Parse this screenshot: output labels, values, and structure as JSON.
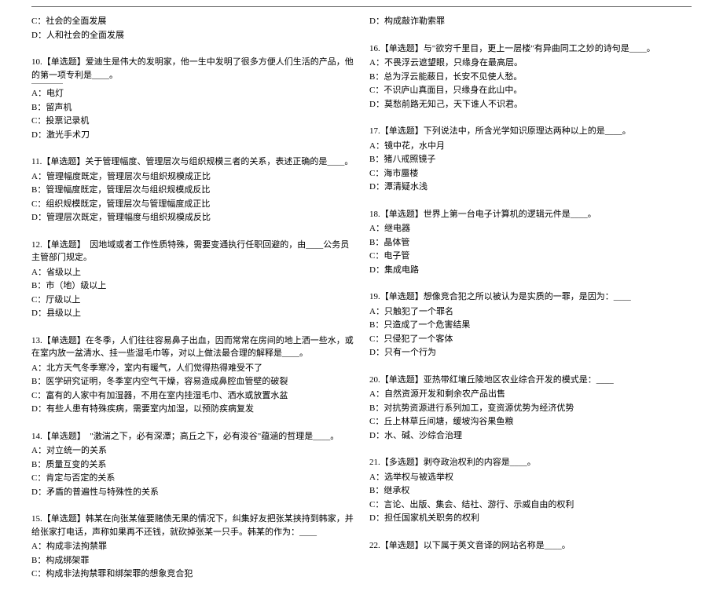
{
  "left": {
    "q9_opts": [
      "C：社会的全面发展",
      "D：人和社会的全面发展"
    ],
    "q10": {
      "stem": "10.【单选题】爱迪生是伟大的发明家，他一生中发明了很多方便人们生活的产品，他的第一项专利是____。",
      "opts": [
        "A：电灯",
        "B：留声机",
        "C：投票记录机",
        "D：激光手术刀"
      ]
    },
    "q11": {
      "stem": "11.【单选题】关于管理幅度、管理层次与组织规模三者的关系，表述正确的是____。",
      "opts": [
        "A：管理幅度既定，管理层次与组织规模成正比",
        "B：管理幅度既定，管理层次与组织规模成反比",
        "C：组织规模既定，管理层次与管理幅度成正比",
        "D：管理层次既定，管理幅度与组织规模成反比"
      ]
    },
    "q12": {
      "stem": "12.【单选题】　因地域或者工作性质特殊，需要变通执行任职回避的，由____公务员主管部门规定。",
      "opts": [
        "A：省级以上",
        "B：市（地）级以上",
        "C：厅级以上",
        "D：县级以上"
      ]
    },
    "q13": {
      "stem": "13.【单选题】在冬季，人们往往容易鼻子出血，因而常常在房间的地上洒一些水，或在室内放一盆清水、挂一些湿毛巾等，对以上做法最合理的解释是____。",
      "opts": [
        "A：北方天气冬季寒冷，室内有暖气，人们觉得热得难受不了",
        "B：医学研究证明，冬季室内空气干燥，容易造成鼻腔血管壁的破裂",
        "C：富有的人家中有加湿器，不用在室内挂湿毛巾、洒水或放置水盆",
        "D：有些人患有特殊疾病，需要室内加湿，以预防疾病复发"
      ]
    },
    "q14": {
      "stem": "14.【单选题】　\"激湍之下，必有深潭；高丘之下，必有浚谷\"蕴涵的哲理是____。",
      "opts": [
        "A：对立统一的关系",
        "B：质量互变的关系",
        "C：肯定与否定的关系",
        "D：矛盾的普遍性与特殊性的关系"
      ]
    },
    "q15": {
      "stem": "15.【单选题】韩某在向张某催要赌债无果的情况下，纠集好友把张某挟持到韩家，并给张家打电话，声称如果再不还钱，就砍掉张某一只手。韩某的作为：____",
      "opts": [
        "A：构成非法拘禁罪",
        "B：构成绑架罪",
        "C：构成非法拘禁罪和绑架罪的想象竞合犯"
      ]
    }
  },
  "right": {
    "q15d": "D：构成敲诈勒索罪",
    "q16": {
      "stem": "16.【单选题】与\"欲穷千里目，更上一层楼\"有异曲同工之妙的诗句是____。",
      "opts": [
        "A：不畏浮云遮望眼，只缘身在最高层。",
        "B：总为浮云能蔽日，长安不见使人愁。",
        "C：不识庐山真面目，只缘身在此山中。",
        "D：莫愁前路无知己，天下谁人不识君。"
      ]
    },
    "q17": {
      "stem": "17.【单选题】下列说法中，所含光学知识原理达两种以上的是____。",
      "opts": [
        "A：镜中花，水中月",
        "B：猪八戒照镜子",
        "C：海市蜃楼",
        "D：潭清疑水浅"
      ]
    },
    "q18": {
      "stem": "18.【单选题】世界上第一台电子计算机的逻辑元件是____。",
      "opts": [
        "A：继电器",
        "B：晶体管",
        "C：电子管",
        "D：集成电路"
      ]
    },
    "q19": {
      "stem": "19.【单选题】想像竞合犯之所以被认为是实质的一罪，是因为：____",
      "opts": [
        "A：只触犯了一个罪名",
        "B：只造成了一个危害结果",
        "C：只侵犯了一个客体",
        "D：只有一个行为"
      ]
    },
    "q20": {
      "stem": "20.【单选题】亚热带红壤丘陵地区农业综合开发的模式是：____",
      "opts": [
        "A：自然资源开发和剩余农产品出售",
        "B：对抗势资源进行系列加工，变资源优势为经济优势",
        "C：丘上林草丘间塘，缓坡沟谷果鱼粮",
        "D：水、碱、沙综合治理"
      ]
    },
    "q21": {
      "stem": "21.【多选题】剥夺政治权利的内容是____。",
      "opts": [
        "A：选举权与被选举权",
        "B：继承权",
        "C：言论、出版、集会、结社、游行、示威自由的权利",
        "D：担任国家机关职务的权利"
      ]
    },
    "q22": {
      "stem": "22.【单选题】以下属于英文音译的网站名称是____。"
    }
  }
}
